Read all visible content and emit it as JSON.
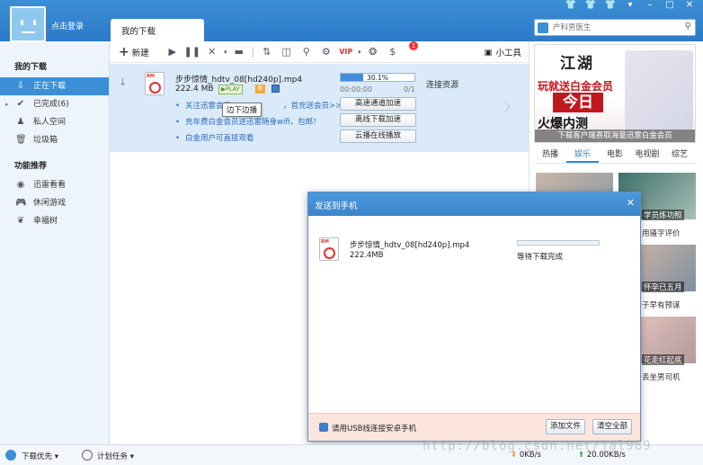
{
  "header": {
    "login_label": "点击登录",
    "tab_label": "我的下载",
    "window_controls": [
      "shirt-icon",
      "shirt-icon",
      "shirt-icon",
      "chevron-down-icon",
      "minimize-icon",
      "maximize-icon",
      "close-icon"
    ]
  },
  "sidebar": {
    "section1": "我的下载",
    "items": [
      {
        "label": "正在下载",
        "icon": "download-icon",
        "active": true
      },
      {
        "label": "已完成(6)",
        "icon": "check-icon",
        "active": false
      },
      {
        "label": "私人空间",
        "icon": "person-icon",
        "active": false
      },
      {
        "label": "垃圾箱",
        "icon": "trash-icon",
        "active": false
      }
    ],
    "section2": "功能推荐",
    "items2": [
      {
        "label": "迅雷看看",
        "icon": "thunder-icon"
      },
      {
        "label": "休闲游戏",
        "icon": "gamepad-icon"
      },
      {
        "label": "幸福树",
        "icon": "leaf-icon"
      }
    ]
  },
  "toolbar": {
    "new_label": "新建",
    "badge_count": "1",
    "tools_label": "小工具"
  },
  "task": {
    "name": "步步惊情_hdtv_08[hd240p].mp4",
    "size": "222.4 MB",
    "play_label": "PLAY",
    "chip_label": "影",
    "links": [
      "关注迅雷会员",
      "，首充送会员>>",
      "充年费白金会员送迅雷随身wifi，包邮！",
      "白金用户可直接观看"
    ],
    "tooltip": "边下边播",
    "progress_text": "30.1%",
    "progress": 0.301,
    "time": "00:00:00",
    "count": "0/1",
    "connect": "连接资源",
    "buttons": [
      "高速通道加速",
      "离线下载加速",
      "云播在线播放"
    ]
  },
  "right": {
    "search_placeholder": "产科男医生",
    "ad": {
      "logo": "江湖",
      "promo": "玩就送白金会员",
      "today": "今日",
      "fire": "火爆内测",
      "caption": "下载客户端喜取海量迅雷白金会员"
    },
    "tabs": [
      {
        "label": "热播",
        "active": false
      },
      {
        "label": "娱乐",
        "active": true
      },
      {
        "label": "电影",
        "active": false
      },
      {
        "label": "电视剧",
        "active": false
      },
      {
        "label": "综艺",
        "active": false
      }
    ],
    "thumbs": [
      {
        "over": "",
        "cap": ""
      },
      {
        "over": "学员炼功照",
        "cap": "用骚字评价"
      },
      {
        "over": "",
        "cap": ""
      },
      {
        "over": "怀孕已五月",
        "cap": "子早有预谋"
      },
      {
        "over": "",
        "cap": ""
      },
      {
        "over": "花走红起底",
        "cap": "丢坐男司机"
      }
    ]
  },
  "dialog": {
    "title": "发送到手机",
    "file_name": "步步惊情_hdtv_08[hd240p].mp4",
    "file_size": "222.4MB",
    "status": "等待下载完成",
    "foot_text": "请用USB线连接安卓手机",
    "add_button": "添加文件",
    "clear_button": "清空全部"
  },
  "statusbar": {
    "priority": "下载优先",
    "plan": "计划任务",
    "down_speed": "0KB/s",
    "up_speed": "20.00KB/s"
  },
  "watermark": "http://blog.csdn.net/jal989"
}
